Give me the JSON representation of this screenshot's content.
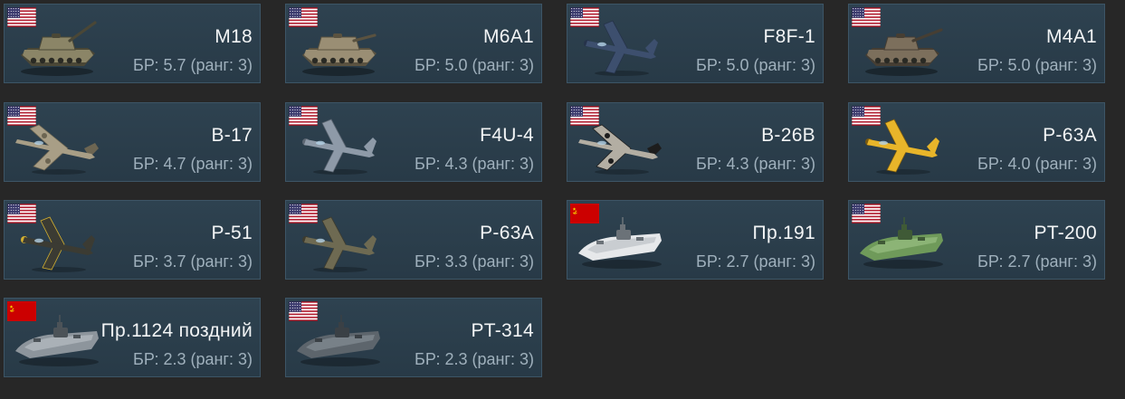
{
  "br_prefix": "БР:",
  "rank_prefix": "ранг:",
  "vehicles": [
    {
      "name": "M18",
      "br": "5.7",
      "rank": "3",
      "nation": "usa",
      "type": "tank",
      "icon": "tank-destroyer-icon"
    },
    {
      "name": "M6A1",
      "br": "5.0",
      "rank": "3",
      "nation": "usa",
      "type": "tank",
      "icon": "heavy-tank-icon"
    },
    {
      "name": "F8F-1",
      "br": "5.0",
      "rank": "3",
      "nation": "usa",
      "type": "plane",
      "icon": "fighter-plane-icon"
    },
    {
      "name": "M4A1",
      "br": "5.0",
      "rank": "3",
      "nation": "usa",
      "type": "tank",
      "icon": "medium-tank-icon"
    },
    {
      "name": "B-17",
      "br": "4.7",
      "rank": "3",
      "nation": "usa",
      "type": "plane",
      "icon": "bomber-plane-icon"
    },
    {
      "name": "F4U-4",
      "br": "4.3",
      "rank": "3",
      "nation": "usa",
      "type": "plane",
      "icon": "fighter-plane-icon"
    },
    {
      "name": "B-26B",
      "br": "4.3",
      "rank": "3",
      "nation": "usa",
      "type": "plane",
      "icon": "bomber-plane-icon"
    },
    {
      "name": "P-63A",
      "br": "4.0",
      "rank": "3",
      "nation": "usa",
      "type": "plane",
      "icon": "fighter-plane-icon"
    },
    {
      "name": "P-51",
      "br": "3.7",
      "rank": "3",
      "nation": "usa",
      "type": "plane",
      "icon": "fighter-plane-icon"
    },
    {
      "name": "P-63A",
      "br": "3.3",
      "rank": "3",
      "nation": "usa",
      "type": "plane",
      "icon": "fighter-plane-icon"
    },
    {
      "name": "Пр.191",
      "br": "2.7",
      "rank": "3",
      "nation": "ussr",
      "type": "boat",
      "icon": "patrol-boat-icon"
    },
    {
      "name": "PT-200",
      "br": "2.7",
      "rank": "3",
      "nation": "usa",
      "type": "boat",
      "icon": "torpedo-boat-icon"
    },
    {
      "name": "Пр.1124 поздний",
      "br": "2.3",
      "rank": "3",
      "nation": "ussr",
      "type": "boat",
      "icon": "armored-boat-icon"
    },
    {
      "name": "PT-314",
      "br": "2.3",
      "rank": "3",
      "nation": "usa",
      "type": "boat",
      "icon": "torpedo-boat-icon"
    }
  ],
  "colors": {
    "background": "#272727",
    "card": "#2e4250",
    "card_border": "#3d5566",
    "name_text": "#f2f4f5",
    "br_text": "#9fb0bc",
    "plane_yellow": "#e8b52a",
    "boat_green": "#6f9a5a",
    "usa_red": "#b22234",
    "usa_blue": "#3c3b6e",
    "ussr_red": "#cc0000"
  }
}
